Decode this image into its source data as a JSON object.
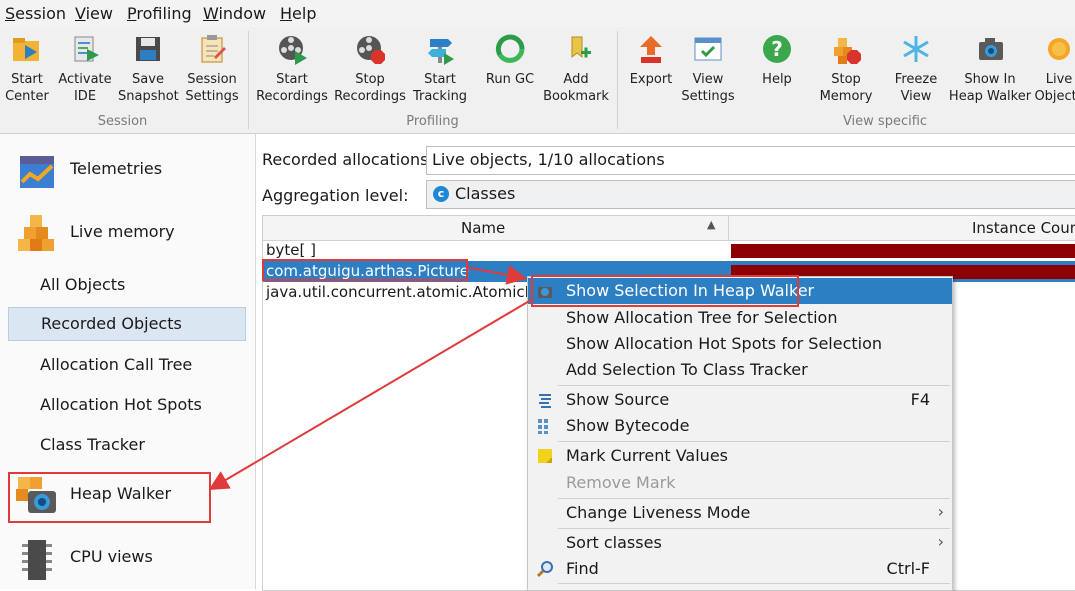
{
  "menubar": {
    "items": [
      {
        "underlined": "S",
        "rest": "ession"
      },
      {
        "underlined": "V",
        "rest": "iew"
      },
      {
        "underlined": "P",
        "rest": "rofiling"
      },
      {
        "underlined": "W",
        "rest": "indow"
      },
      {
        "underlined": "H",
        "rest": "elp"
      }
    ]
  },
  "toolbar": {
    "buttons": [
      {
        "label": "Start\nCenter"
      },
      {
        "label": "Activate\nIDE"
      },
      {
        "label": "Save\nSnapshot"
      },
      {
        "label": "Session\nSettings"
      },
      {
        "label": "Start\nRecordings"
      },
      {
        "label": "Stop\nRecordings"
      },
      {
        "label": "Start\nTracking"
      },
      {
        "label": "Run GC"
      },
      {
        "label": "Add\nBookmark"
      },
      {
        "label": "Export"
      },
      {
        "label": "View\nSettings"
      },
      {
        "label": "Help"
      },
      {
        "label": "Stop\nMemory"
      },
      {
        "label": "Freeze\nView"
      },
      {
        "label": "Show In\nHeap Walker"
      },
      {
        "label": "Live\nObjects"
      }
    ],
    "groups": {
      "session": "Session",
      "profiling": "Profiling",
      "view_specific": "View specific"
    },
    "colors": {
      "accent": "#2d7fc3",
      "danger": "#c0392b"
    }
  },
  "sidebar": {
    "telemetries": "Telemetries",
    "live_memory": "Live memory",
    "sub_items": [
      {
        "label": "All Objects"
      },
      {
        "label": "Recorded Objects"
      },
      {
        "label": "Allocation Call Tree"
      },
      {
        "label": "Allocation Hot Spots"
      },
      {
        "label": "Class Tracker"
      }
    ],
    "heap_walker": "Heap Walker",
    "cpu_views": "CPU views"
  },
  "main": {
    "recorded_label": "Recorded allocations:",
    "recorded_value": "Live objects, 1/10 allocations",
    "aggregation_label": "Aggregation level:",
    "aggregation_value": "Classes",
    "columns": {
      "name": "Name",
      "instance_count": "Instance Count"
    },
    "rows": [
      {
        "name": "byte[ ]"
      },
      {
        "name": "com.atguigu.arthas.Picture"
      },
      {
        "name": "java.util.concurrent.atomic.AtomicLong"
      }
    ]
  },
  "context_menu": {
    "show_in_heap_walker": "Show Selection In Heap Walker",
    "alloc_tree": "Show Allocation Tree for Selection",
    "alloc_hot_spots": "Show Allocation Hot Spots for Selection",
    "add_to_tracker": "Add Selection To Class Tracker",
    "show_source": "Show Source",
    "show_source_key": "F4",
    "show_bytecode": "Show Bytecode",
    "mark_values": "Mark Current Values",
    "remove_mark": "Remove Mark",
    "liveness": "Change Liveness Mode",
    "sort": "Sort classes",
    "find": "Find",
    "find_key": "Ctrl-F"
  }
}
